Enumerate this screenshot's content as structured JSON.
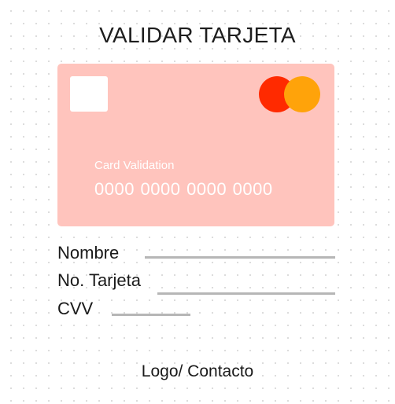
{
  "title": "VALIDAR TARJETA",
  "card": {
    "label": "Card Validation",
    "number": "0000 0000 0000 0000",
    "chip_icon": "card-chip-icon",
    "brand_icon": "mastercard-logo-icon",
    "colors": {
      "background": "#ffc4bd",
      "brand_left": "#ff2a00",
      "brand_right": "#ffa30a"
    }
  },
  "form": {
    "name_label": "Nombre",
    "card_number_label": "No. Tarjeta",
    "cvv_label": "CVV"
  },
  "footer": {
    "text": "Logo/ Contacto"
  }
}
